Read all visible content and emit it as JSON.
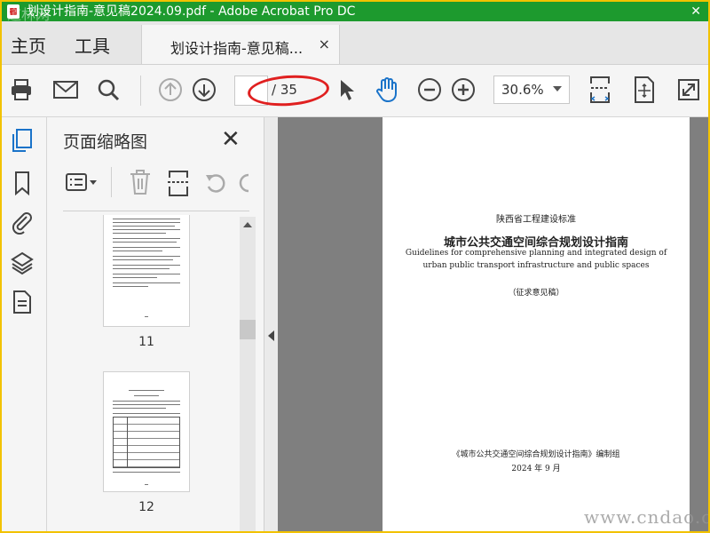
{
  "window": {
    "title": "划设计指南-意见稿2024.09.pdf - Adobe Acrobat Pro DC",
    "watermark_top": "道林网",
    "close_glyph": "✕"
  },
  "nav": {
    "home_label": "主页",
    "tools_label": "工具",
    "doc_tab_label": "划设计指南-意见稿...",
    "doc_tab_close": "×"
  },
  "toolbar": {
    "page_current": "",
    "page_total": "/ 35",
    "zoom": "30.6%",
    "icons": [
      "print-icon",
      "mail-icon",
      "search-icon",
      "page-up-icon",
      "page-down-icon",
      "select-arrow-icon",
      "hand-icon",
      "zoom-out-icon",
      "zoom-in-icon",
      "fit-width-icon",
      "fit-page-icon",
      "fullscreen-icon"
    ]
  },
  "panel": {
    "title": "页面缩略图",
    "close": "✕",
    "thumbnails": [
      {
        "number": "11"
      },
      {
        "number": "12"
      }
    ]
  },
  "document": {
    "standard_line": "陕西省工程建设标准",
    "title_cn": "城市公共交通空间综合规划设计指南",
    "title_en_1": "Guidelines for comprehensive planning and integrated design of",
    "title_en_2": "urban public transport infrastructure and public spaces",
    "draft_note": "（征求意见稿）",
    "editor": "《城市公共交通空间综合规划设计指南》编制组",
    "date": "2024 年 9 月"
  },
  "watermark_bottom": "www.cndao.co",
  "colors": {
    "titlebar": "#1d9a2e",
    "accent_blue": "#1a73c9",
    "highlight_red": "#e02020"
  }
}
